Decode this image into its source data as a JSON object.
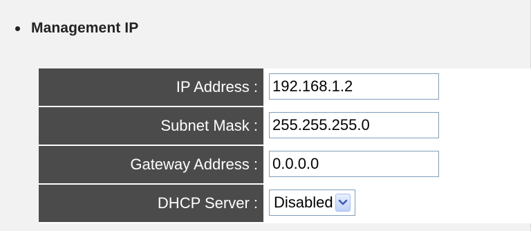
{
  "section": {
    "title": "Management IP"
  },
  "fields": {
    "ip_address": {
      "label": "IP Address :",
      "value": "192.168.1.2"
    },
    "subnet_mask": {
      "label": "Subnet Mask :",
      "value": "255.255.255.0"
    },
    "gateway_address": {
      "label": "Gateway Address :",
      "value": "0.0.0.0"
    },
    "dhcp_server": {
      "label": "DHCP Server :",
      "selected": "Disabled",
      "arrow_icon": "chevron-down-icon"
    }
  },
  "colors": {
    "label_bg": "#4b4b4b",
    "label_text": "#ffffff",
    "panel_bg": "#f2f2f2",
    "input_border": "#7f9db9",
    "dropdown_arrow": "#3c5bb5"
  }
}
